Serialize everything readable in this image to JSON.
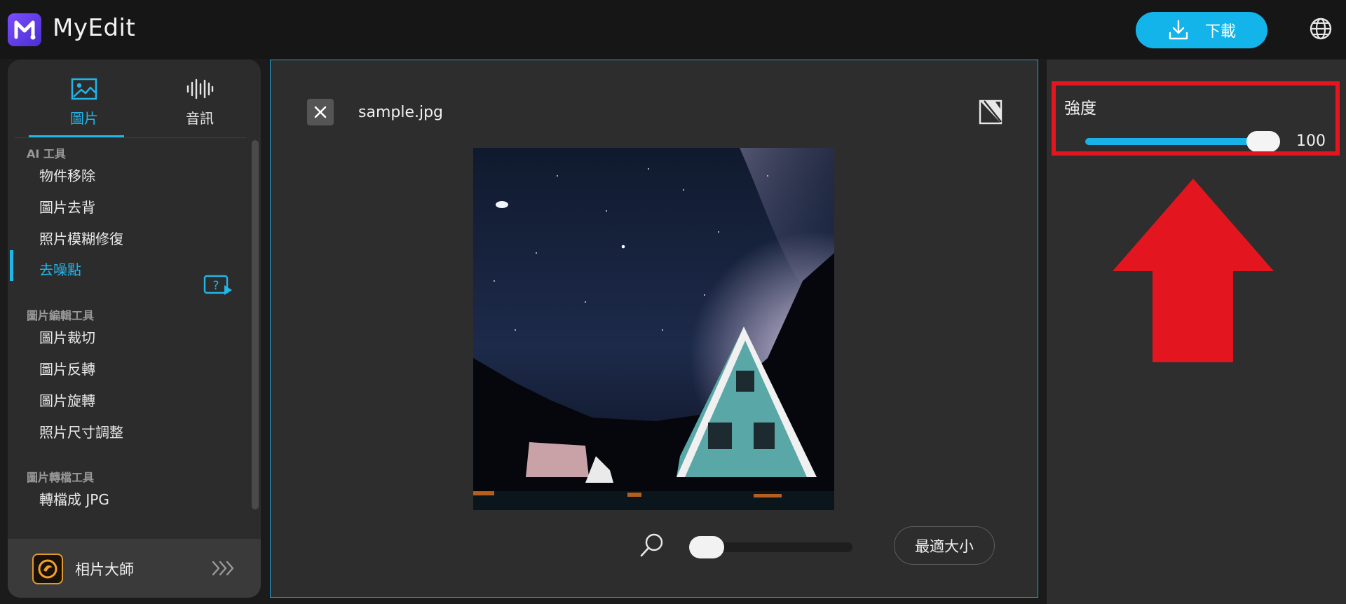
{
  "app": {
    "name": "MyEdit"
  },
  "header": {
    "download_label": "下載"
  },
  "sidebar": {
    "tabs": [
      {
        "label": "圖片",
        "icon": "image-icon",
        "active": true
      },
      {
        "label": "音訊",
        "icon": "waveform-icon",
        "active": false
      }
    ],
    "sections": [
      {
        "title": "AI 工具",
        "items": [
          "物件移除",
          "圖片去背",
          "照片模糊修復",
          "去噪點"
        ]
      },
      {
        "title": "圖片編輯工具",
        "items": [
          "圖片裁切",
          "圖片反轉",
          "圖片旋轉",
          "照片尺寸調整"
        ]
      },
      {
        "title": "圖片轉檔工具",
        "items": [
          "轉檔成 JPG"
        ]
      }
    ],
    "active_item": "去噪點",
    "footer": {
      "label": "相片大師",
      "icon": "photodirector-icon"
    }
  },
  "editor": {
    "filename": "sample.jpg",
    "zoom": {
      "level": 0.0
    },
    "fit_label": "最適大小"
  },
  "settings": {
    "strength_label": "強度",
    "strength_value": "100",
    "strength_fraction": 1.0
  },
  "colors": {
    "accent": "#21b5e8",
    "highlight": "#e3161f"
  }
}
